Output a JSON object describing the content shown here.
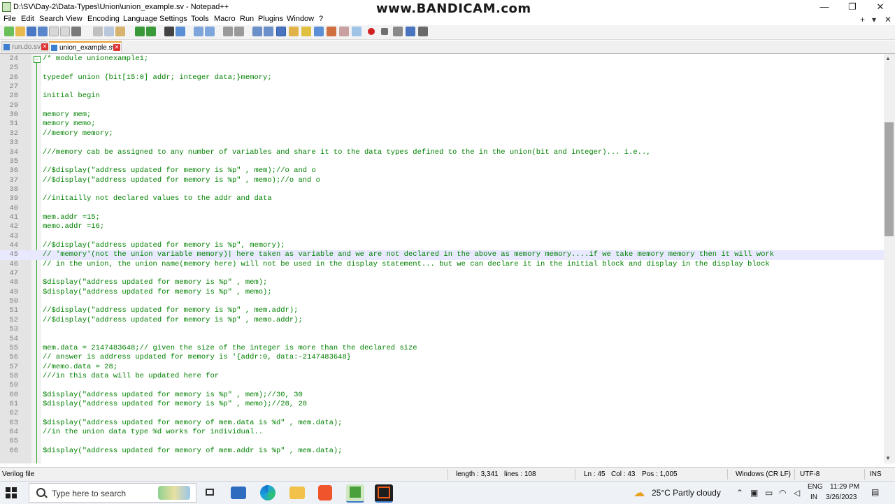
{
  "window": {
    "title": "D:\\SV\\Day-2\\Data-Types\\Union\\union_example.sv - Notepad++",
    "watermark": "www.BANDICAM.com",
    "minimize": "—",
    "maximize": "❐",
    "close": "✕"
  },
  "menu": {
    "items": [
      "File",
      "Edit",
      "Search",
      "View",
      "Encoding",
      "Language",
      "Settings",
      "Tools",
      "Macro",
      "Run",
      "Plugins",
      "Window",
      "?"
    ],
    "right_plus": "+",
    "right_down": "▾",
    "right_close": "✕"
  },
  "tabs": [
    {
      "label": "run.do.sv",
      "active": false
    },
    {
      "label": "union_example.sv",
      "active": true
    }
  ],
  "tab_close_glyph": "✕",
  "editor": {
    "current_line": 45,
    "lines": [
      {
        "n": "24",
        "t": "/* module unionexample1;"
      },
      {
        "n": "25",
        "t": ""
      },
      {
        "n": "26",
        "t": "typedef union {bit[15:0] addr; integer data;}memory;"
      },
      {
        "n": "27",
        "t": ""
      },
      {
        "n": "28",
        "t": "initial begin"
      },
      {
        "n": "29",
        "t": ""
      },
      {
        "n": "30",
        "t": "memory mem;"
      },
      {
        "n": "31",
        "t": "memory memo;"
      },
      {
        "n": "32",
        "t": "//memory memory;"
      },
      {
        "n": "33",
        "t": ""
      },
      {
        "n": "34",
        "t": "///memory cab be assigned to any number of variables and share it to the data types defined to the in the union(bit and integer)... i.e..,"
      },
      {
        "n": "35",
        "t": ""
      },
      {
        "n": "36",
        "t": "//$display(\"address updated for memory is %p\" , mem);//o and o"
      },
      {
        "n": "37",
        "t": "//$display(\"address updated for memory is %p\" , memo);//o and o"
      },
      {
        "n": "38",
        "t": ""
      },
      {
        "n": "39",
        "t": "//initailly not declared values to the addr and data"
      },
      {
        "n": "40",
        "t": ""
      },
      {
        "n": "41",
        "t": "mem.addr =15;"
      },
      {
        "n": "42",
        "t": "memo.addr =16;"
      },
      {
        "n": "43",
        "t": ""
      },
      {
        "n": "44",
        "t": "//$display(\"address updated for memory is %p\", memory);"
      },
      {
        "n": "45",
        "t": "// 'memory'(not the union variable memory)| here taken as variable and we are not declared in the above as memory memory....if we take memory memory then it will work"
      },
      {
        "n": "46",
        "t": "// in the union, the union name(memory here) will not be used in the display statement... but we can declare it in the initial block and display in the display block"
      },
      {
        "n": "47",
        "t": ""
      },
      {
        "n": "48",
        "t": "$display(\"address updated for memory is %p\" , mem);"
      },
      {
        "n": "49",
        "t": "$display(\"address updated for memory is %p\" , memo);"
      },
      {
        "n": "50",
        "t": ""
      },
      {
        "n": "51",
        "t": "//$display(\"address updated for memory is %p\" , mem.addr);"
      },
      {
        "n": "52",
        "t": "//$display(\"address updated for memory is %p\" , memo.addr);"
      },
      {
        "n": "53",
        "t": ""
      },
      {
        "n": "54",
        "t": ""
      },
      {
        "n": "55",
        "t": "mem.data = 2147483648;// given the size of the integer is more than the declared size"
      },
      {
        "n": "56",
        "t": "// answer is address updated for memory is '{addr:0, data:-2147483648}"
      },
      {
        "n": "57",
        "t": "//memo.data = 28;"
      },
      {
        "n": "58",
        "t": "///in this data will be updated here for"
      },
      {
        "n": "59",
        "t": ""
      },
      {
        "n": "60",
        "t": "$display(\"address updated for memory is %p\" , mem);//30, 30"
      },
      {
        "n": "61",
        "t": "$display(\"address updated for memory is %p\" , memo);//28, 28"
      },
      {
        "n": "62",
        "t": ""
      },
      {
        "n": "63",
        "t": "$display(\"address updated for memory of mem.data is %d\" , mem.data);"
      },
      {
        "n": "64",
        "t": "//in the union data type %d works for individual.."
      },
      {
        "n": "65",
        "t": ""
      },
      {
        "n": "66",
        "t": "$display(\"address updated for memory of mem.addr is %p\" , mem.data);"
      }
    ]
  },
  "status": {
    "file_type": "Verilog file",
    "length": "length : 3,341",
    "lines": "lines : 108",
    "ln": "Ln : 45",
    "col": "Col : 43",
    "pos": "Pos : 1,005",
    "eol": "Windows (CR LF)",
    "encoding": "UTF-8",
    "mode": "INS"
  },
  "taskbar": {
    "search_placeholder": "Type here to search",
    "weather": "25°C  Partly cloudy",
    "lang_top": "ENG",
    "lang_bottom": "IN",
    "time": "11:29 PM",
    "date": "3/26/2023"
  },
  "colors": {
    "code_green": "#008000",
    "current_line_bg": "#e8e8ff",
    "line_number_gray": "#808080"
  }
}
